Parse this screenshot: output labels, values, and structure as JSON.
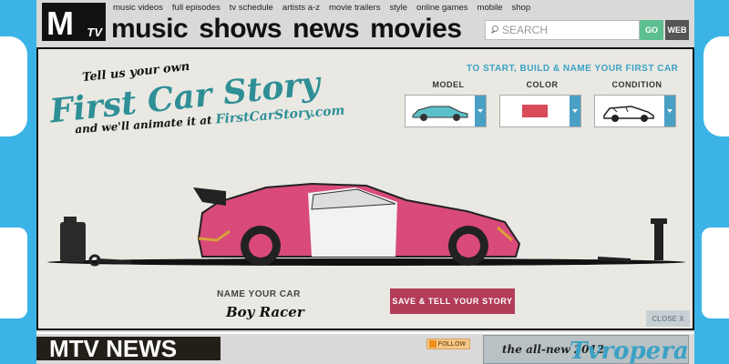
{
  "header": {
    "logo": {
      "letter": "M",
      "suffix": "TV"
    },
    "subnav": [
      "music videos",
      "full episodes",
      "tv schedule",
      "artists a-z",
      "movie trailers",
      "style",
      "online games",
      "mobile",
      "shop"
    ],
    "bignav": [
      "music",
      "shows",
      "news",
      "movies"
    ],
    "search": {
      "placeholder": "SEARCH",
      "go_label": "GO",
      "web_label": "WEB"
    }
  },
  "promo": {
    "tagline_top": "Tell us your own",
    "title": "First Car Story",
    "tagline_bottom": "and we'll animate it at",
    "site": "FirstCarStory.com",
    "build_title": "TO START, BUILD & NAME YOUR FIRST CAR",
    "pickers": [
      {
        "label": "MODEL",
        "icon": "car-model-icon"
      },
      {
        "label": "COLOR",
        "icon": "color-swatch-icon"
      },
      {
        "label": "CONDITION",
        "icon": "car-condition-icon"
      }
    ],
    "name_label": "NAME YOUR CAR",
    "name_value": "Boy Racer",
    "save_label": "SAVE & TELL YOUR STORY",
    "close_label": "CLOSE X",
    "colors": {
      "accent": "#2f8f96",
      "car": "#d94a7a",
      "save": "#b33c59"
    }
  },
  "news": {
    "title": "MTV NEWS",
    "follow_label": "FOLLOW"
  },
  "ad": {
    "line1": "the all-new 2012",
    "line2": "Tvropera"
  }
}
